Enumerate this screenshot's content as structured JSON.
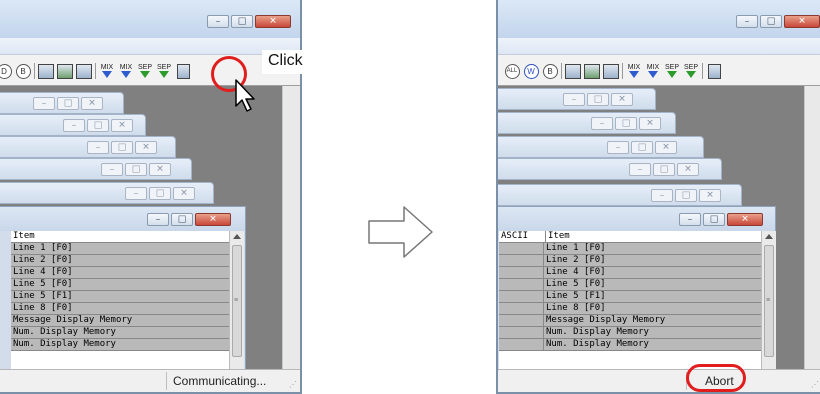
{
  "annotation": {
    "click_label": "Click"
  },
  "window_buttons": {
    "minimize": "–",
    "maximize": "□",
    "close": "✕"
  },
  "toolbar": {
    "mix_label": "MIX",
    "sep_label": "SEP",
    "all_badge": "ALL",
    "w_badge": "W",
    "b_badge": "B",
    "d_badge": "D"
  },
  "list": {
    "columns": [
      "ASCII",
      "Item"
    ],
    "items": [
      "Line 1 [F0]",
      "Line 2 [F0]",
      "Line 4 [F0]",
      "Line 5 [F0]",
      "Line 5 [F1]",
      "Line 8 [F0]",
      "Message Display Memory",
      "Num. Display Memory",
      "Num. Display Memory"
    ]
  },
  "status": {
    "before": "Communicating...",
    "after": "Abort"
  },
  "colors": {
    "highlight": "#e01e1e",
    "mdi_background": "#808080",
    "row_fill": "#b9b9b9"
  }
}
